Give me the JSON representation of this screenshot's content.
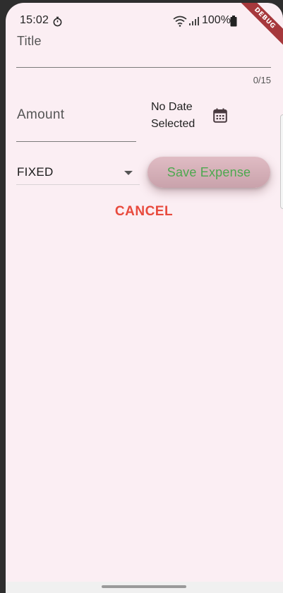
{
  "status_bar": {
    "time": "15:02",
    "battery": "100%"
  },
  "debug_banner": "DEBUG",
  "form": {
    "title_label": "Title",
    "title_counter": "0/15",
    "amount_label": "Amount",
    "date_line1": "No Date",
    "date_line2": "Selected",
    "category_selected": "FIXED",
    "save_label": "Save Expense",
    "cancel_label": "CANCEL"
  },
  "colors": {
    "background": "#fbeef3",
    "save_text": "#4da84f",
    "cancel_text": "#e84a3d",
    "debug_banner": "#a6383c"
  },
  "icons": {
    "timer": "timer-icon",
    "wifi": "wifi-icon",
    "signal": "signal-icon",
    "battery": "battery-icon",
    "calendar": "calendar-icon",
    "dropdown": "arrow-drop-down-icon"
  }
}
